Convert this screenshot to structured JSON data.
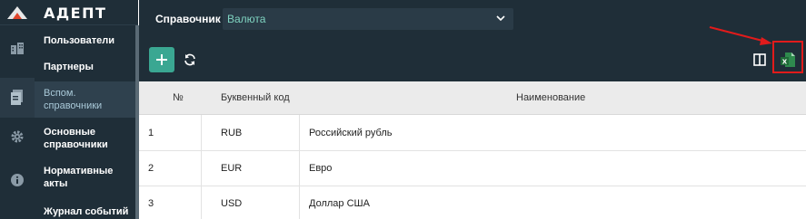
{
  "app": {
    "logo_text": "АДЕПТ"
  },
  "rail": {
    "icons": [
      "building-icon",
      "documents-icon",
      "gear-icon",
      "info-icon"
    ]
  },
  "menu": {
    "items": [
      {
        "label": "Пользователи"
      },
      {
        "label": "Партнеры"
      },
      {
        "label_line1": "Вспом.",
        "label_line2": "справочники"
      },
      {
        "label_line1": "Основные",
        "label_line2": "справочники"
      },
      {
        "label_line1": "Нормативные",
        "label_line2": "акты"
      },
      {
        "label": "Журнал событий"
      }
    ]
  },
  "toolbar": {
    "reference_label": "Справочник",
    "reference_value": "Валюта"
  },
  "table": {
    "columns": [
      "№",
      "Буквенный код",
      "Наименование"
    ],
    "rows": [
      {
        "num": "1",
        "code": "RUB",
        "name": "Российский рубль"
      },
      {
        "num": "2",
        "code": "EUR",
        "name": "Евро"
      },
      {
        "num": "3",
        "code": "USD",
        "name": "Доллар США"
      }
    ]
  },
  "colors": {
    "sidebar_bg": "#1f2e38",
    "accent_green": "#3aa792",
    "select_text": "#7fd3c0",
    "highlight_red": "#e11b1b"
  }
}
